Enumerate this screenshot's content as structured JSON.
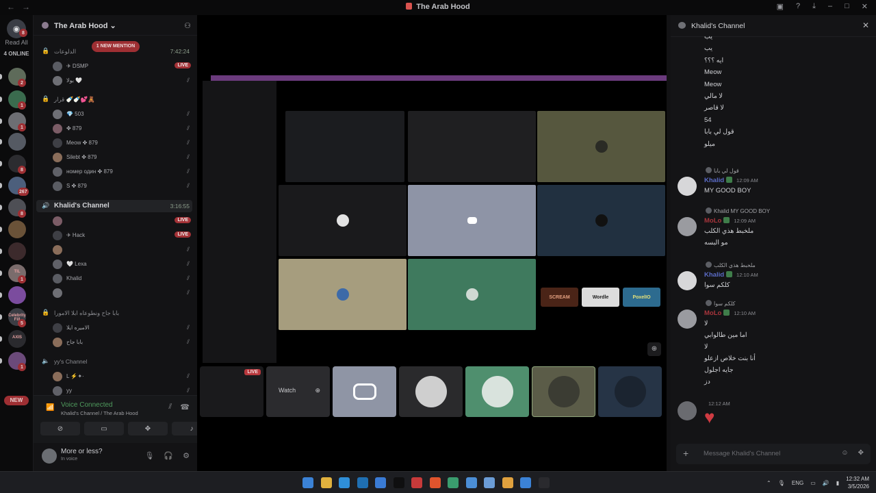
{
  "window": {
    "title": "The Arab Hood"
  },
  "rail": {
    "home_badge": "8",
    "read_all": "Read All",
    "online": "4 ONLINE",
    "new_label": "NEW",
    "servers": [
      {
        "badge": "2",
        "color": "#5e6b5a",
        "text": ""
      },
      {
        "badge": "1",
        "color": "#3a6b4e",
        "text": ""
      },
      {
        "badge": "1",
        "color": "#6d6e73",
        "text": ""
      },
      {
        "badge": "",
        "color": "#555a63",
        "text": ""
      },
      {
        "badge": "8",
        "color": "#2c2c30",
        "text": ""
      },
      {
        "badge": "267",
        "color": "#4c5f7c",
        "text": ""
      },
      {
        "badge": "8",
        "color": "#4e4f55",
        "text": ""
      },
      {
        "badge": "",
        "color": "#6a5238",
        "text": ""
      },
      {
        "badge": "",
        "color": "#3c2a2c",
        "text": ""
      },
      {
        "badge": "1",
        "color": "#7a6c6c",
        "text": "TIL"
      },
      {
        "badge": "",
        "color": "#7b4c9e",
        "text": ""
      },
      {
        "badge": "5",
        "color": "#3b3d44",
        "text": "Celebrity Fill"
      },
      {
        "badge": "",
        "color": "#2a2a2e",
        "text": "AXIS"
      },
      {
        "badge": "1",
        "color": "#6b4a7a",
        "text": ""
      }
    ]
  },
  "sidebar": {
    "server_name": "The Arab Hood",
    "mention": "1 NEW MENTION",
    "channels": [
      {
        "name": "الدلوعات",
        "time": "7:42:24",
        "users": [
          {
            "name": "✈ DSMP",
            "live": "LIVE"
          },
          {
            "name": "بولا 🤍",
            "live": ""
          }
        ]
      },
      {
        "name": "قرار 🍼🍼💕🧸",
        "time": "",
        "users": [
          {
            "name": "💎 503",
            "live": ""
          },
          {
            "name": "✤ 879",
            "live": ""
          },
          {
            "name": "Meow ✤ 879",
            "live": ""
          },
          {
            "name": "Silebt ✤ 879",
            "live": ""
          },
          {
            "name": "номер один ✤ 879",
            "live": ""
          },
          {
            "name": "S ✤ 879",
            "live": ""
          }
        ]
      },
      {
        "name": "Khalid's Channel",
        "time": "3:16:55",
        "users": [
          {
            "name": "",
            "live": "LIVE"
          },
          {
            "name": "✈ Hack",
            "live": "LIVE"
          },
          {
            "name": "",
            "live": ""
          },
          {
            "name": "🤍 Lexa",
            "live": ""
          },
          {
            "name": "Khalid",
            "live": ""
          },
          {
            "name": "",
            "live": ""
          }
        ]
      },
      {
        "name": "بابا جاح ونطوعاه ابلا الامورا",
        "time": "",
        "users": [
          {
            "name": "الاميره ايلا",
            "live": ""
          },
          {
            "name": "بابا جاح",
            "live": ""
          }
        ]
      },
      {
        "name": "yy's Channel",
        "time": "",
        "users": [
          {
            "name": "L ⚡✦·",
            "live": ""
          },
          {
            "name": "yy",
            "live": ""
          }
        ]
      }
    ]
  },
  "voice": {
    "status": "Voice Connected",
    "location": "Khalid's Channel / The Arab Hood"
  },
  "user": {
    "name": "More or less?",
    "status": "In voice"
  },
  "stage": {
    "inner_title": "The Arab Hood",
    "watch": "Watch",
    "live": "LIVE",
    "games": [
      "SCREAM",
      "Wordle",
      "PoxelIO"
    ],
    "thumb_colors": [
      "#1a1a1c",
      "#2b2b2e",
      "#8f95a5",
      "#2a2a2c",
      "#4f8f6e",
      "#5b5c48",
      "#263446"
    ]
  },
  "chat": {
    "title": "Khalid's Channel",
    "input_placeholder": "Message Khalid's Channel",
    "lines_top": [
      "يب",
      "يب",
      "ايه ؟؟؟",
      "Meow",
      "Meow",
      "لا مالي",
      "لا قاصر",
      "54",
      "قول لي بابا",
      "ميلو"
    ],
    "messages": [
      {
        "reply": "قول لي بابا",
        "user": "Khalid",
        "color": "#5b6cc7",
        "time": "12:09 AM",
        "lines": [
          "MY GOOD BOY"
        ]
      },
      {
        "reply": "Khalid MY GOOD BOY",
        "user": "MoLo",
        "color": "#a8353c",
        "time": "12:09 AM",
        "lines": [
          "ملخبط هذي الكلب",
          "مو البسه"
        ]
      },
      {
        "reply": "ملخبط هذي الكلب",
        "user": "Khalid",
        "color": "#5b6cc7",
        "time": "12:10 AM",
        "lines": [
          "كلكم سوا"
        ]
      },
      {
        "reply": "كلكم سوا",
        "user": "MoLo",
        "color": "#a8353c",
        "time": "12:10 AM",
        "lines": [
          "لا",
          "اما مين طالوابي",
          "لا",
          "أنا بنت خلاص ازعلو",
          "جايه اجلول",
          "دز"
        ]
      },
      {
        "reply": "",
        "user": "",
        "color": "#d0d1d5",
        "time": "12:12 AM",
        "lines": []
      }
    ]
  },
  "taskbar": {
    "lang": "ENG",
    "time": "12:32 AM",
    "date": "3/5/2026"
  }
}
